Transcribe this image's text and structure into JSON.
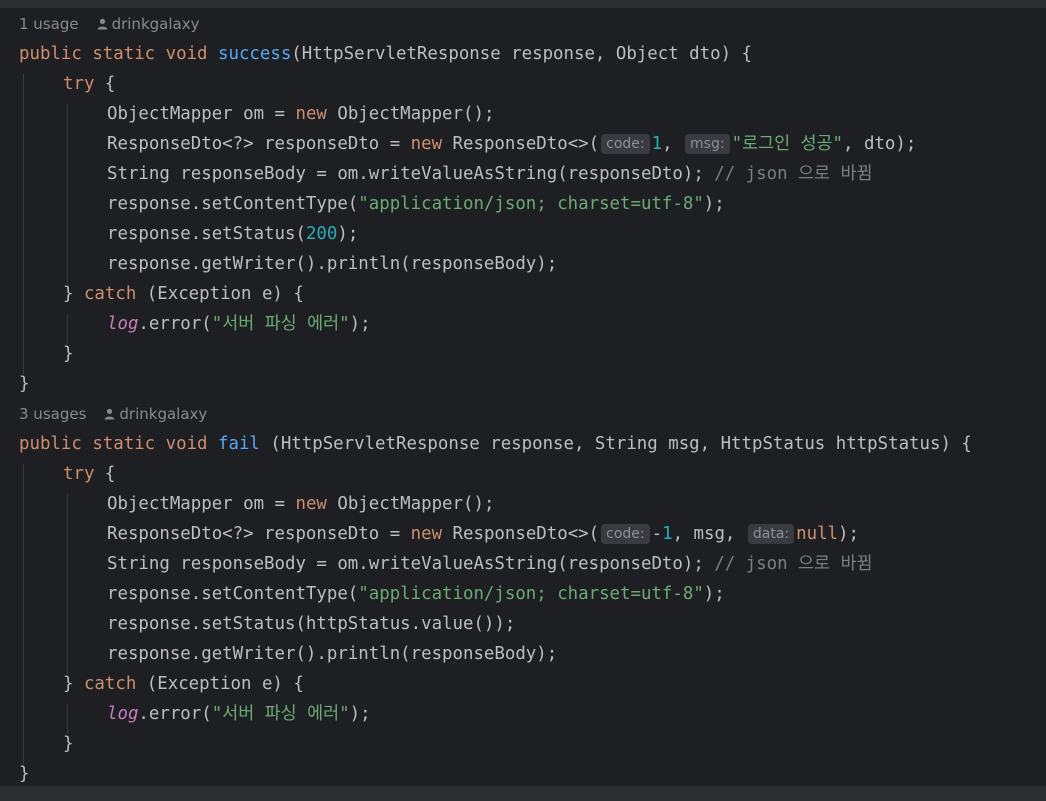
{
  "success_block": {
    "usages": "1 usage",
    "author": "drinkgalaxy",
    "kw_public": "public",
    "kw_static": "static",
    "kw_void": "void",
    "method_name": "success",
    "params": "(HttpServletResponse response, Object dto) {",
    "kw_try": "try",
    "brace_open": " {",
    "om_decl": "ObjectMapper om = ",
    "kw_new": "new",
    "om_ctor": " ObjectMapper();",
    "dto_decl": "ResponseDto<?> responseDto = ",
    "dto_ctor": " ResponseDto<>(",
    "hint_code": "code:",
    "code_value": "1",
    "comma": ", ",
    "hint_msg": "msg:",
    "msg_value": "\"로그인 성공\"",
    "dto_tail": ", dto);",
    "body_decl": "String responseBody = om.writeValueAsString(responseDto); ",
    "body_comment": "// json 으로 바뀜",
    "ct_call": "response.setContentType(",
    "ct_value": "\"application/json; charset=utf-8\"",
    "ct_tail": ");",
    "status_call": "response.setStatus(",
    "status_value": "200",
    "status_tail": ");",
    "writer_line": "response.getWriter().println(responseBody);",
    "catch_open": "} ",
    "kw_catch": "catch",
    "catch_params": " (Exception e) {",
    "log_field": "log",
    "log_call": ".error(",
    "log_msg": "\"서버 파싱 에러\"",
    "log_tail": ");",
    "inner_close": "}",
    "outer_close": "}"
  },
  "fail_block": {
    "usages": "3 usages",
    "author": "drinkgalaxy",
    "kw_public": "public",
    "kw_static": "static",
    "kw_void": "void",
    "method_name": "fail",
    "params": " (HttpServletResponse response, String msg, HttpStatus httpStatus) {",
    "kw_try": "try",
    "brace_open": " {",
    "om_decl": "ObjectMapper om = ",
    "kw_new": "new",
    "om_ctor": " ObjectMapper();",
    "dto_decl": "ResponseDto<?> responseDto = ",
    "dto_ctor": " ResponseDto<>(",
    "hint_code": "code:",
    "code_minus": "-",
    "code_value": "1",
    "dto_mid": ", msg, ",
    "hint_data": "data:",
    "data_value": "null",
    "dto_tail": ");",
    "body_decl": "String responseBody = om.writeValueAsString(responseDto); ",
    "body_comment": "// json 으로 바뀜",
    "ct_call": "response.setContentType(",
    "ct_value": "\"application/json; charset=utf-8\"",
    "ct_tail": ");",
    "status_line": "response.setStatus(httpStatus.value());",
    "writer_line": "response.getWriter().println(responseBody);",
    "catch_open": "} ",
    "kw_catch": "catch",
    "catch_params": " (Exception e) {",
    "log_field": "log",
    "log_call": ".error(",
    "log_msg": "\"서버 파싱 에러\"",
    "log_tail": ");",
    "inner_close": "}",
    "outer_close": "}"
  },
  "colors": {
    "background": "#1e1f22",
    "keyword": "#cf8e6d",
    "function": "#56a8f5",
    "string": "#6aab73",
    "number": "#2aacb8",
    "comment": "#7a7e85",
    "field": "#c77dbb",
    "text": "#bcbec4"
  },
  "icons": {
    "author": "person-icon"
  }
}
